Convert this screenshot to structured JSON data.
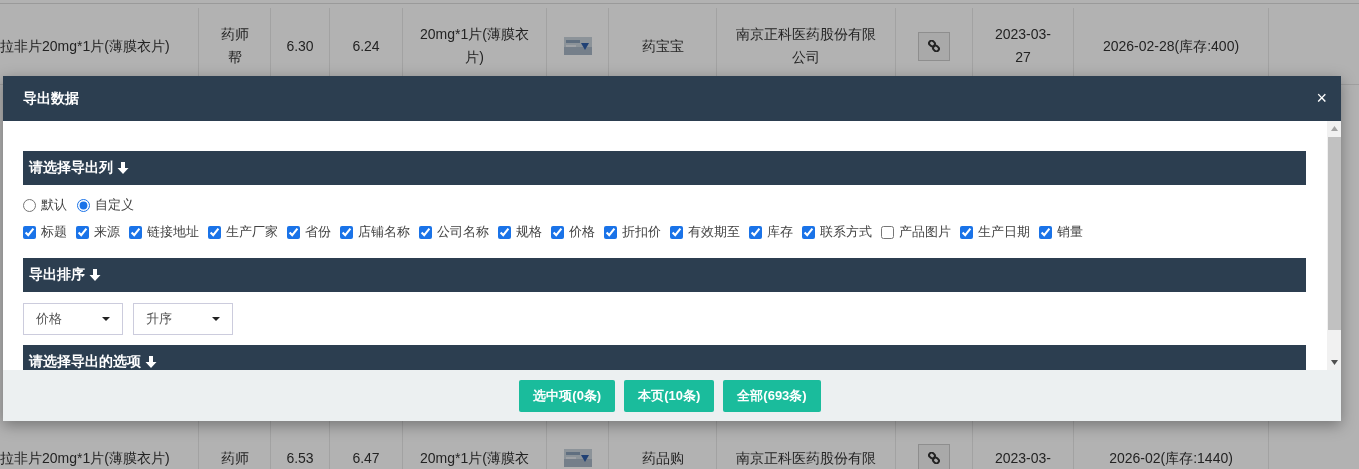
{
  "background_table": {
    "rows": [
      {
        "cells": [
          {
            "kind": "text",
            "text": "拉非片20mg*1片(薄膜衣片)"
          },
          {
            "kind": "text",
            "text": "药师帮"
          },
          {
            "kind": "text",
            "text": "6.30"
          },
          {
            "kind": "text",
            "text": "6.24"
          },
          {
            "kind": "text",
            "text": "20mg*1片(薄膜衣片)"
          },
          {
            "kind": "picture"
          },
          {
            "kind": "text",
            "text": "药宝宝"
          },
          {
            "kind": "text",
            "text": "南京正科医药股份有限公司"
          },
          {
            "kind": "link_button"
          },
          {
            "kind": "text",
            "text": "2023-03-27"
          },
          {
            "kind": "text",
            "text": "2026-02-28(库存:400)"
          },
          {
            "kind": "empty"
          }
        ]
      },
      {
        "cells": [
          {
            "kind": "text",
            "text": "拉非片20mg*1片(薄膜衣片)"
          },
          {
            "kind": "text",
            "text": "药师"
          },
          {
            "kind": "text",
            "text": "6.53"
          },
          {
            "kind": "text",
            "text": "6.47"
          },
          {
            "kind": "text",
            "text": "20mg*1片(薄膜衣"
          },
          {
            "kind": "picture"
          },
          {
            "kind": "text",
            "text": "药品购"
          },
          {
            "kind": "text",
            "text": "南京正科医药股份有限"
          },
          {
            "kind": "link_button"
          },
          {
            "kind": "text",
            "text": "2023-03-"
          },
          {
            "kind": "text",
            "text": "2026-02(库存:1440)"
          },
          {
            "kind": "empty"
          }
        ]
      }
    ]
  },
  "modal": {
    "title": "导出数据",
    "close": "×",
    "sections": [
      {
        "kind": "columns",
        "title": "请选择导出列",
        "modes": [
          {
            "label": "默认",
            "selected": false
          },
          {
            "label": "自定义",
            "selected": true
          }
        ],
        "columns": [
          {
            "label": "标题",
            "checked": true
          },
          {
            "label": "来源",
            "checked": true
          },
          {
            "label": "链接地址",
            "checked": true
          },
          {
            "label": "生产厂家",
            "checked": true
          },
          {
            "label": "省份",
            "checked": true
          },
          {
            "label": "店铺名称",
            "checked": true
          },
          {
            "label": "公司名称",
            "checked": true
          },
          {
            "label": "规格",
            "checked": true
          },
          {
            "label": "价格",
            "checked": true
          },
          {
            "label": "折扣价",
            "checked": true
          },
          {
            "label": "有效期至",
            "checked": true
          },
          {
            "label": "库存",
            "checked": true
          },
          {
            "label": "联系方式",
            "checked": true
          },
          {
            "label": "产品图片",
            "checked": false
          },
          {
            "label": "生产日期",
            "checked": true
          },
          {
            "label": "销量",
            "checked": true
          }
        ]
      },
      {
        "kind": "sort",
        "title": "导出排序",
        "selects": [
          {
            "value": "价格"
          },
          {
            "value": "升序"
          }
        ]
      },
      {
        "kind": "options",
        "title": "请选择导出的选项"
      }
    ],
    "buttons": [
      "选中项(0条)",
      "本页(10条)",
      "全部(693条)"
    ]
  }
}
